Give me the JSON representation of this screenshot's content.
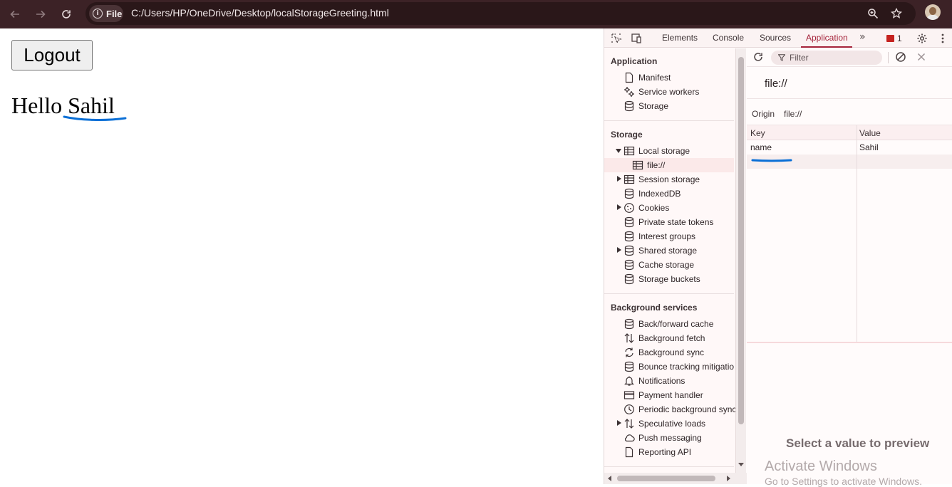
{
  "browser": {
    "security_chip_label": "File",
    "url": "C:/Users/HP/OneDrive/Desktop/localStorageGreeting.html"
  },
  "page": {
    "logout_label": "Logout",
    "greeting_prefix": "Hello",
    "greeting_name": "Sahil"
  },
  "devtools": {
    "tabs": [
      "Elements",
      "Console",
      "Sources",
      "Application"
    ],
    "active_tab": "Application",
    "issues_count": "1",
    "sidebar": {
      "application_title": "Application",
      "application_items": [
        "Manifest",
        "Service workers",
        "Storage"
      ],
      "storage_title": "Storage",
      "storage_items": [
        "Local storage",
        "file://",
        "Session storage",
        "IndexedDB",
        "Cookies",
        "Private state tokens",
        "Interest groups",
        "Shared storage",
        "Cache storage",
        "Storage buckets"
      ],
      "background_title": "Background services",
      "background_items": [
        "Back/forward cache",
        "Background fetch",
        "Background sync",
        "Bounce tracking mitigatio",
        "Notifications",
        "Payment handler",
        "Periodic background sync",
        "Speculative loads",
        "Push messaging",
        "Reporting API"
      ]
    },
    "main": {
      "filter_placeholder": "Filter",
      "origin_heading": "file://",
      "origin_label": "Origin",
      "origin_value": "file://",
      "columns": [
        "Key",
        "Value"
      ],
      "rows": [
        {
          "key": "name",
          "value": "Sahil"
        }
      ],
      "preview_empty": "Select a value to preview"
    },
    "watermark": {
      "title": "Activate Windows",
      "subtitle": "Go to Settings to activate Windows."
    }
  },
  "colors": {
    "topbar": "#3c2226",
    "accent": "#a5243b",
    "scribble": "#0a6fd6"
  }
}
